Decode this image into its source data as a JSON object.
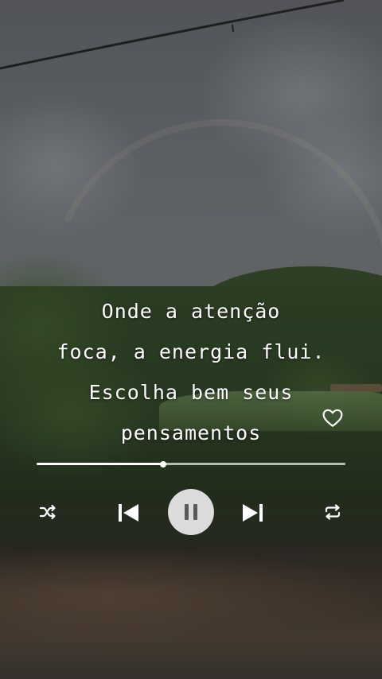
{
  "quote": {
    "lines": [
      "Onde a atenção",
      "foca, a energia flui.",
      "Escolha bem seus",
      "pensamentos"
    ]
  },
  "player": {
    "progress": 0.41,
    "state": "playing",
    "liked": false,
    "icons": {
      "like": "heart-outline-icon",
      "shuffle": "shuffle-icon",
      "previous": "skip-previous-icon",
      "playback": "pause-icon",
      "next": "skip-next-icon",
      "repeat": "repeat-icon"
    }
  },
  "colors": {
    "controls": "#ffffff",
    "play_button_bg": "#ebebeb",
    "pause_glyph": "#5a5a5a"
  }
}
